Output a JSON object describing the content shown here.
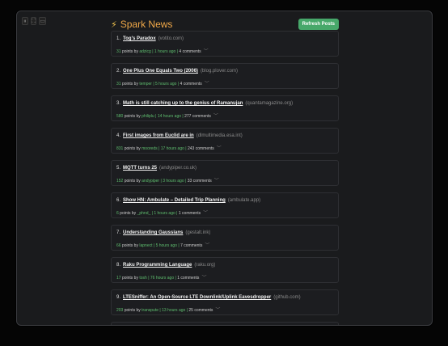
{
  "app": {
    "title": "Spark News",
    "refresh_label": "Refresh Posts"
  },
  "window_controls": [
    "⏸",
    "⛶",
    "▭"
  ],
  "posts": [
    {
      "rank": "1.",
      "title": "Tog's Paradox",
      "domain": "(votito.com)",
      "points": "31",
      "points_label": "points by",
      "user": "adzicg",
      "age": "1 hours ago",
      "comments": "4 comments"
    },
    {
      "rank": "2.",
      "title": "One Plus One Equals Two (2006)",
      "domain": "(blog.plover.com)",
      "points": "31",
      "points_label": "points by",
      "user": "temper",
      "age": "5 hours ago",
      "comments": "4 comments"
    },
    {
      "rank": "3.",
      "title": "Math is still catching up to the genius of Ramanujan",
      "domain": "(quantamagazine.org)",
      "points": "580",
      "points_label": "points by",
      "user": "philiplu",
      "age": "14 hours ago",
      "comments": "277 comments"
    },
    {
      "rank": "4.",
      "title": "First images from Euclid are in",
      "domain": "(dlmultimedia.esa.int)",
      "points": "831",
      "points_label": "points by",
      "user": "mooreds",
      "age": "17 hours ago",
      "comments": "243 comments"
    },
    {
      "rank": "5.",
      "title": "MQTT turns 25",
      "domain": "(andypiper.co.uk)",
      "points": "152",
      "points_label": "points by",
      "user": "andypiper",
      "age": "3 hours ago",
      "comments": "33 comments"
    },
    {
      "rank": "6.",
      "title": "Show HN: Ambulate – Detailed Trip Planning",
      "domain": "(ambulate.app)",
      "points": "6",
      "points_label": "points by",
      "user": "_phnd_",
      "age": "1 hours ago",
      "comments": "1 comments"
    },
    {
      "rank": "7.",
      "title": "Understanding Gaussians",
      "domain": "(gestalt.ink)",
      "points": "66",
      "points_label": "points by",
      "user": "lapnect",
      "age": "5 hours ago",
      "comments": "7 comments"
    },
    {
      "rank": "8.",
      "title": "Raku Programming Language",
      "domain": "(raku.org)",
      "points": "17",
      "points_label": "points by",
      "user": "tosh",
      "age": "76 hours ago",
      "comments": "1 comments"
    },
    {
      "rank": "9.",
      "title": "LTESniffer: An Open-Source LTE Downlink/Uplink Eavesdropper",
      "domain": "(github.com)",
      "points": "203",
      "points_label": "points by",
      "user": "transpute",
      "age": "13 hours ago",
      "comments": "25 comments"
    },
    {
      "rank": "",
      "title": "",
      "domain": "",
      "points": "",
      "points_label": "",
      "user": "",
      "age": "",
      "comments": ""
    }
  ]
}
